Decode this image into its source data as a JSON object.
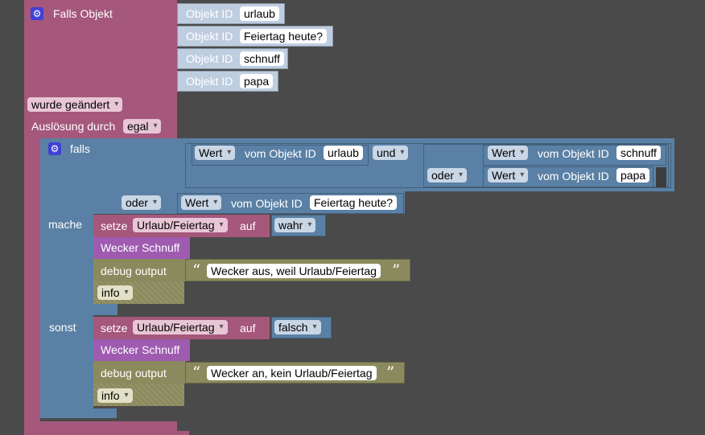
{
  "trigger": {
    "title": "Falls Objekt",
    "object_label": "Objekt ID",
    "objects": [
      "urlaub",
      "Feiertag heute?",
      "schnuff",
      "papa"
    ],
    "condition_value": "wurde geändert",
    "trigger_by_label": "Auslösung durch",
    "trigger_by_value": "egal"
  },
  "if_block": {
    "falls_label": "falls",
    "mache_label": "mache",
    "sonst_label": "sonst",
    "value_label": "Wert",
    "from_object_label": "vom Objekt ID",
    "and_op": "und",
    "or_op": "oder",
    "cond_obj_1": "urlaub",
    "cond_obj_2": "schnuff",
    "cond_obj_3": "papa",
    "cond_obj_4": "Feiertag heute?"
  },
  "then_branch": {
    "set_label": "setze",
    "variable": "Urlaub/Feiertag",
    "to_label": "auf",
    "value": "wahr",
    "function_call": "Wecker Schnuff",
    "debug_label": "debug output",
    "message": "Wecker aus, weil Urlaub/Feiertag",
    "level": "info"
  },
  "else_branch": {
    "set_label": "setze",
    "variable": "Urlaub/Feiertag",
    "to_label": "auf",
    "value": "falsch",
    "function_call": "Wecker Schnuff",
    "debug_label": "debug output",
    "message": "Wecker an, kein Urlaub/Feiertag",
    "level": "info"
  },
  "colors": {
    "workspace": "#4a4a4a",
    "trigger_block": "#a5577c",
    "logic_block": "#5a80a5",
    "object_block": "#bfcde0",
    "function_block": "#9e5bb0",
    "debug_block": "#8b8a5e"
  }
}
